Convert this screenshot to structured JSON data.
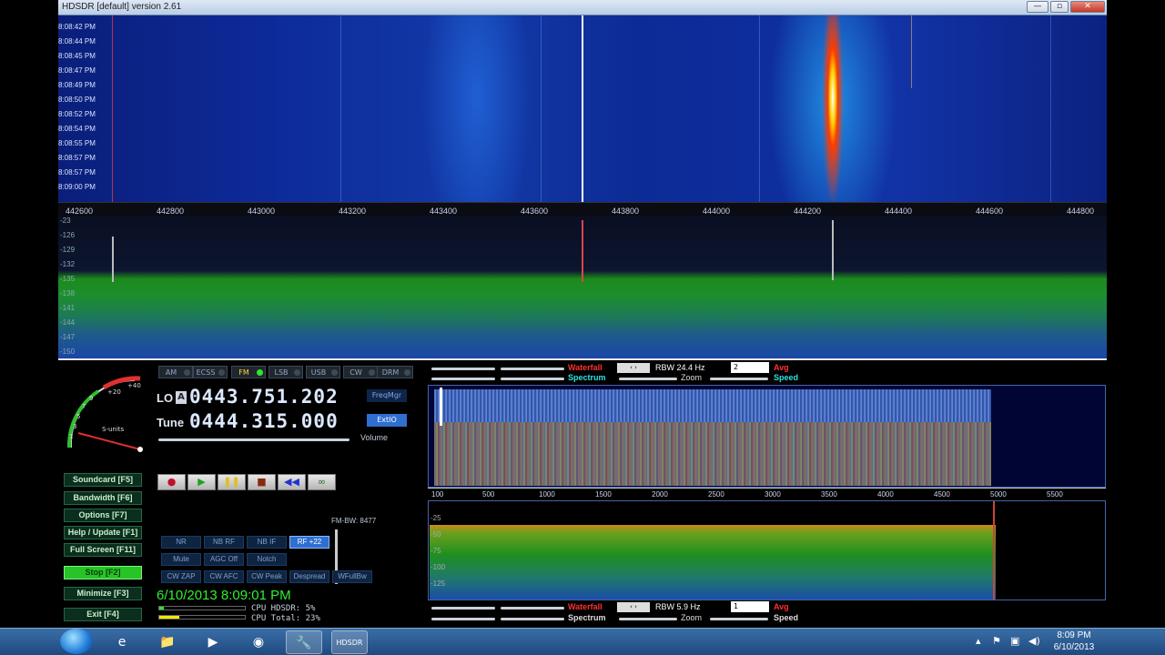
{
  "window": {
    "title": "HDSDR [default]  version 2.61",
    "minimize": "—",
    "maximize": "▫",
    "close": "✕"
  },
  "waterfall": {
    "timestamps": [
      "8:08:42 PM",
      "8:08:44 PM",
      "8:08:45 PM",
      "8:08:47 PM",
      "8:08:49 PM",
      "8:08:50 PM",
      "8:08:52 PM",
      "8:08:54 PM",
      "8:08:55 PM",
      "8:08:57 PM",
      "8:08:57 PM",
      "8:09:00 PM"
    ],
    "freq_ticks": [
      "442600",
      "442800",
      "443000",
      "443200",
      "443400",
      "443600",
      "443800",
      "444000",
      "444200",
      "444400",
      "444600",
      "444800"
    ]
  },
  "spectrum": {
    "db_labels": [
      "-23",
      "-126",
      "-129",
      "-132",
      "-135",
      "-138",
      "-141",
      "-144",
      "-147",
      "-150"
    ]
  },
  "modes": [
    {
      "label": "AM",
      "active": false
    },
    {
      "label": "ECSS",
      "active": false
    },
    {
      "label": "FM",
      "active": true
    },
    {
      "label": "LSB",
      "active": false
    },
    {
      "label": "USB",
      "active": false
    },
    {
      "label": "CW",
      "active": false
    },
    {
      "label": "DRM",
      "active": false
    }
  ],
  "smeter": {
    "label": "S-units",
    "scale": [
      "1",
      "3",
      "5",
      "7",
      "9",
      "+20",
      "+40"
    ]
  },
  "lo": {
    "label": "LO",
    "badge": "A",
    "value": "0443.751.202"
  },
  "tune": {
    "label": "Tune",
    "value": "0444.315.000"
  },
  "freqmgr": "FreqMgr",
  "extio": "ExtIO",
  "volume": "Volume",
  "side_buttons": [
    {
      "label": "Soundcard  [F5]",
      "style": "normal"
    },
    {
      "label": "Bandwidth  [F6]",
      "style": "normal"
    },
    {
      "label": "Options  [F7]",
      "style": "normal"
    },
    {
      "label": "Help / Update  [F1]",
      "style": "normal"
    },
    {
      "label": "Full Screen  [F11]",
      "style": "normal"
    },
    {
      "label": "Stop  [F2]",
      "style": "green"
    },
    {
      "label": "Minimize  [F3]",
      "style": "normal"
    },
    {
      "label": "Exit  [F4]",
      "style": "normal"
    }
  ],
  "transport": [
    "●",
    "▶",
    "❚❚",
    "■",
    "◀◀",
    "∞"
  ],
  "fm_bw": "FM-BW: 8477",
  "dsp_rows": [
    [
      "NR",
      "NB RF",
      "NB IF",
      "RF +22"
    ],
    [
      "Mute",
      "AGC Off",
      "Notch"
    ],
    [
      "CW ZAP",
      "CW AFC",
      "CW Peak",
      "Despread",
      "WFullBw"
    ]
  ],
  "datetime": "6/10/2013 8:09:01 PM",
  "cpu": {
    "hdsdr": "CPU HDSDR:  5%",
    "total": "CPU Total: 23%"
  },
  "audio_top_controls": {
    "waterfall": "Waterfall",
    "spectrum": "Spectrum",
    "rbw": "RBW  24.4 Hz",
    "avg_value": "2",
    "avg": "Avg",
    "zoom": "Zoom",
    "speed": "Speed"
  },
  "audio_bottom_controls": {
    "waterfall": "Waterfall",
    "spectrum": "Spectrum",
    "rbw": "RBW   5.9 Hz",
    "avg_value": "1",
    "avg": "Avg",
    "zoom": "Zoom",
    "speed": "Speed"
  },
  "audio_scale": [
    "100",
    "500",
    "1000",
    "1500",
    "2000",
    "2500",
    "3000",
    "3500",
    "4000",
    "4500",
    "5000",
    "5500"
  ],
  "audio_db": [
    "-25",
    "-50",
    "-75",
    "-100",
    "-125"
  ],
  "taskbar": {
    "apps": [
      "e",
      "📁",
      "▶",
      "◉",
      "🔧",
      "HDSDR"
    ],
    "clock_time": "8:09 PM",
    "clock_date": "6/10/2013"
  }
}
